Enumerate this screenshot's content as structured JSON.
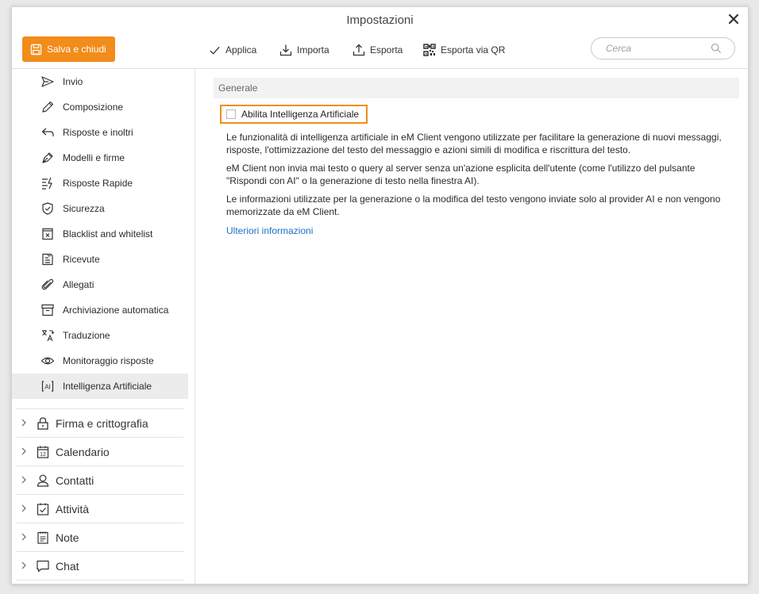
{
  "window": {
    "title": "Impostazioni"
  },
  "toolbar": {
    "save_label": "Salva e chiudi",
    "apply_label": "Applica",
    "import_label": "Importa",
    "export_label": "Esporta",
    "export_qr_label": "Esporta via QR",
    "search_placeholder": "Cerca"
  },
  "sidebar": {
    "items": [
      {
        "label": "Invio",
        "icon": "send-icon"
      },
      {
        "label": "Composizione",
        "icon": "pencil-icon"
      },
      {
        "label": "Risposte e inoltri",
        "icon": "reply-icon"
      },
      {
        "label": "Modelli e firme",
        "icon": "pen-nib-icon"
      },
      {
        "label": "Risposte Rapide",
        "icon": "quick-reply-icon"
      },
      {
        "label": "Sicurezza",
        "icon": "shield-icon"
      },
      {
        "label": "Blacklist and whitelist",
        "icon": "blacklist-icon"
      },
      {
        "label": "Ricevute",
        "icon": "receipt-icon"
      },
      {
        "label": "Allegati",
        "icon": "paperclip-icon"
      },
      {
        "label": "Archiviazione automatica",
        "icon": "archive-icon"
      },
      {
        "label": "Traduzione",
        "icon": "translate-icon"
      },
      {
        "label": "Monitoraggio risposte",
        "icon": "eye-icon"
      },
      {
        "label": "Intelligenza Artificiale",
        "icon": "ai-icon",
        "active": true
      }
    ],
    "groups": [
      {
        "label": "Firma e crittografia",
        "icon": "lock-icon"
      },
      {
        "label": "Calendario",
        "icon": "calendar-icon"
      },
      {
        "label": "Contatti",
        "icon": "person-icon"
      },
      {
        "label": "Attività",
        "icon": "task-icon"
      },
      {
        "label": "Note",
        "icon": "note-icon"
      },
      {
        "label": "Chat",
        "icon": "chat-icon"
      }
    ]
  },
  "content": {
    "section_title": "Generale",
    "enable_ai_label": "Abilita Intelligenza Artificiale",
    "enable_ai_checked": false,
    "paragraph1": "Le funzionalità di intelligenza artificiale in eM Client vengono utilizzate per facilitare la generazione di nuovi messaggi, risposte, l'ottimizzazione del testo del messaggio e azioni simili di modifica e riscrittura del testo.",
    "paragraph2": "eM Client non invia mai testo o query al server senza un'azione esplicita dell'utente (come l'utilizzo del pulsante \"Rispondi con AI\" o la generazione di testo nella finestra AI).",
    "paragraph3": "Le informazioni utilizzate per la generazione o la modifica del testo vengono inviate solo al provider AI e non vengono memorizzate da eM Client.",
    "more_info_link": "Ulteriori informazioni"
  },
  "colors": {
    "accent": "#f28c1a",
    "link": "#1a73c9",
    "active_item": "#ececec"
  }
}
